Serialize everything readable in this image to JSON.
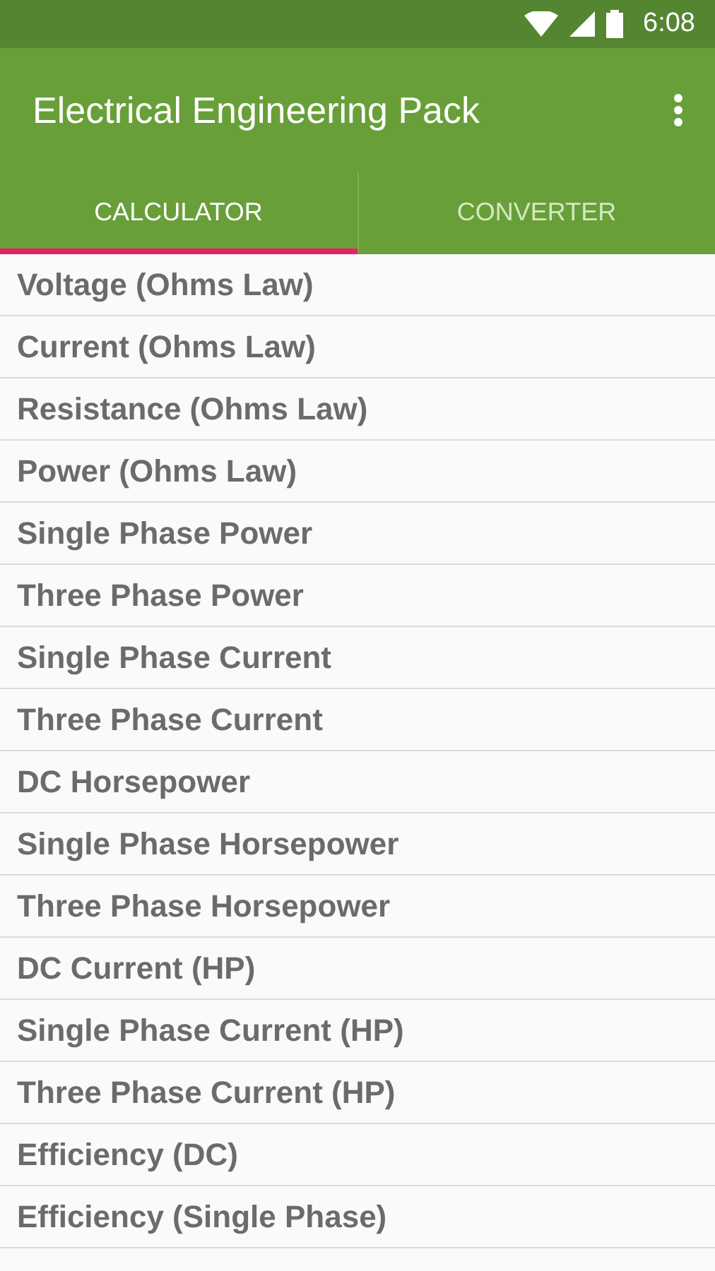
{
  "status_bar": {
    "time": "6:08"
  },
  "app_bar": {
    "title": "Electrical Engineering Pack"
  },
  "tabs": [
    {
      "label": "CALCULATOR",
      "selected": true
    },
    {
      "label": "CONVERTER",
      "selected": false
    }
  ],
  "items": [
    "Voltage (Ohms Law)",
    "Current (Ohms Law)",
    "Resistance (Ohms Law)",
    "Power (Ohms Law)",
    "Single Phase Power",
    "Three Phase Power",
    "Single Phase Current",
    "Three Phase Current",
    "DC Horsepower",
    "Single Phase Horsepower",
    "Three Phase Horsepower",
    "DC Current (HP)",
    "Single Phase Current (HP)",
    "Three Phase Current (HP)",
    "Efficiency (DC)",
    "Efficiency (Single Phase)"
  ]
}
